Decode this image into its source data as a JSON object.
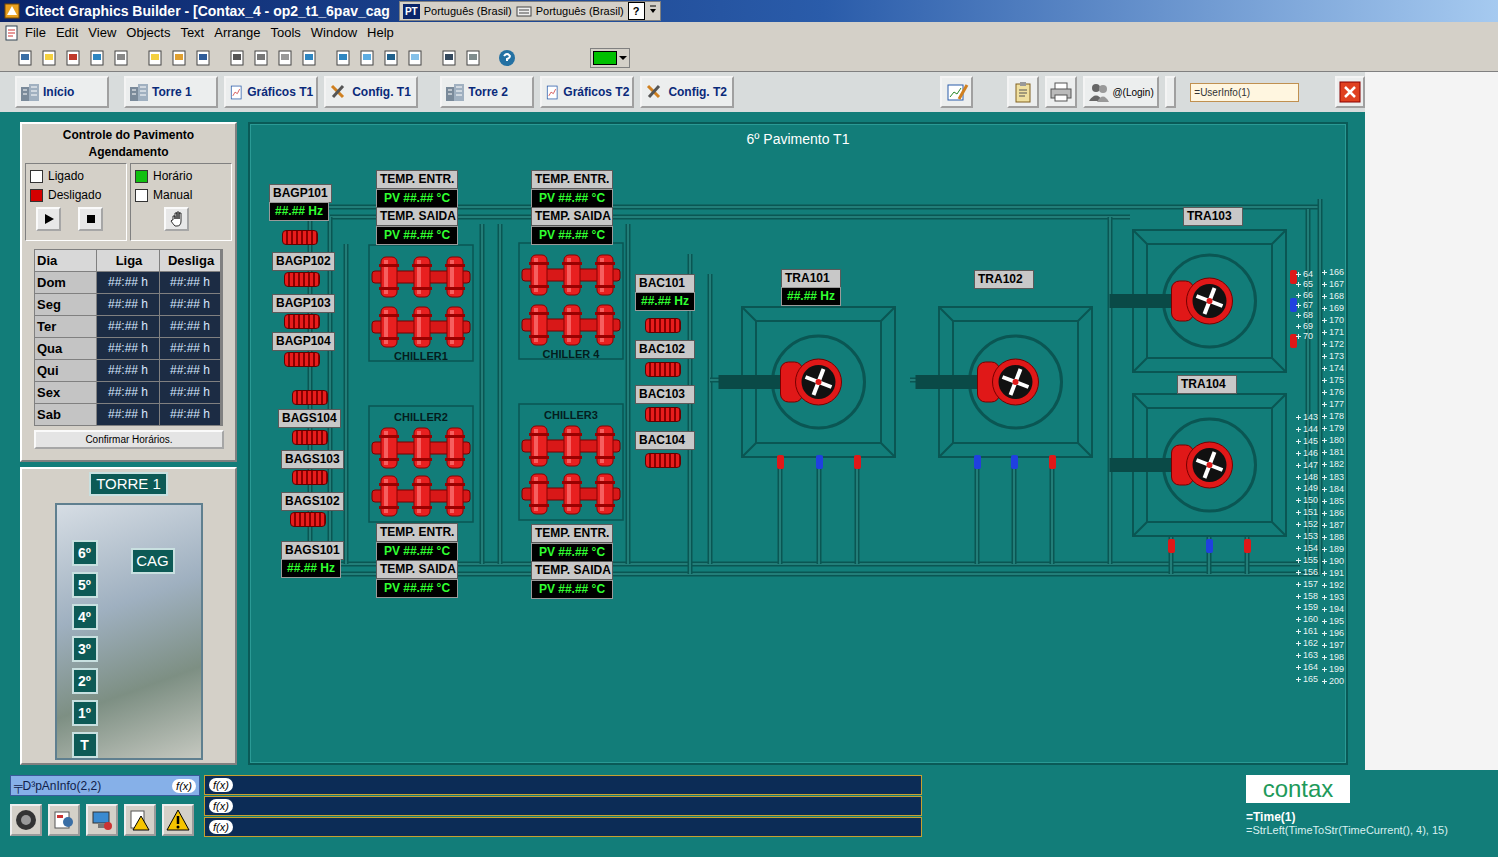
{
  "window": {
    "title": "Citect Graphics Builder - [Contax_4 - op2_t1_6pav_cag",
    "language_bar": [
      "PT",
      "Português (Brasil)",
      "Português (Brasil)",
      "?"
    ]
  },
  "menu": [
    "File",
    "Edit",
    "View",
    "Objects",
    "Text",
    "Arrange",
    "Tools",
    "Window",
    "Help"
  ],
  "toolbar": {
    "fill_color": "#00c000"
  },
  "nav": {
    "buttons": [
      "Início",
      "Torre 1",
      "Gráficos T1",
      "Config. T1",
      "Torre 2",
      "Gráficos T2",
      "Config. T2"
    ],
    "login": "@(Login)",
    "user_info": "=UserInfo(1)"
  },
  "schedule": {
    "title": "Controle do Pavimento",
    "subtitle": "Agendamento",
    "status": [
      {
        "label": "Ligado",
        "checked": false,
        "color": "#10c010"
      },
      {
        "label": "Desligado",
        "checked": true,
        "color": "#d40000"
      }
    ],
    "mode": [
      {
        "label": "Horário",
        "selected": true
      },
      {
        "label": "Manual",
        "selected": false
      }
    ],
    "columns": [
      "Dia",
      "Liga",
      "Desliga"
    ],
    "rows": [
      [
        "Dom",
        "##:## h",
        "##:## h"
      ],
      [
        "Seg",
        "##:## h",
        "##:## h"
      ],
      [
        "Ter",
        "##:## h",
        "##:## h"
      ],
      [
        "Qua",
        "##:## h",
        "##:## h"
      ],
      [
        "Qui",
        "##:## h",
        "##:## h"
      ],
      [
        "Sex",
        "##:## h",
        "##:## h"
      ],
      [
        "Sab",
        "##:## h",
        "##:## h"
      ]
    ],
    "confirm": "Confirmar Horários."
  },
  "tower": {
    "title": "TORRE 1",
    "floors": [
      "6º",
      "5º",
      "4º",
      "3º",
      "2º",
      "1º",
      "T"
    ],
    "cag": "CAG"
  },
  "diagram": {
    "title": "6º Pavimento T1",
    "pumps": [
      {
        "label": "BAGP101",
        "reading": "##.## Hz"
      },
      {
        "label": "BAGP102"
      },
      {
        "label": "BAGP103"
      },
      {
        "label": "BAGP104"
      },
      {
        "label": "BAGS104"
      },
      {
        "label": "BAGS103"
      },
      {
        "label": "BAGS102"
      },
      {
        "label": "BAGS101",
        "reading": "##.## Hz"
      }
    ],
    "condenser_pumps": [
      {
        "label": "BAC101",
        "reading": "##.## Hz"
      },
      {
        "label": "BAC102"
      },
      {
        "label": "BAC103"
      },
      {
        "label": "BAC104"
      }
    ],
    "temperatures": [
      {
        "label": "TEMP. ENTR.",
        "reading": "PV ##.## °C"
      },
      {
        "label": "TEMP. SAIDA",
        "reading": "PV ##.## °C"
      },
      {
        "label": "TEMP. ENTR.",
        "reading": "PV ##.## °C"
      },
      {
        "label": "TEMP. SAIDA",
        "reading": "PV ##.## °C"
      },
      {
        "label": "TEMP. ENTR.",
        "reading": "PV ##.## °C"
      },
      {
        "label": "TEMP. SAIDA",
        "reading": "PV ##.## °C"
      },
      {
        "label": "TEMP. ENTR.",
        "reading": "PV ##.## °C"
      },
      {
        "label": "TEMP. SAIDA",
        "reading": "PV ##.## °C"
      }
    ],
    "chillers": [
      "CHILLER1",
      "CHILLER 4",
      "CHILLER2",
      "CHILLER3"
    ],
    "towers": [
      {
        "label": "TRA101",
        "reading": "##.## Hz"
      },
      {
        "label": "TRA102"
      },
      {
        "label": "TRA103"
      },
      {
        "label": "TRA104"
      }
    ],
    "scale_left_top": [
      "64",
      "65",
      "66",
      "67",
      "68",
      "69",
      "70"
    ],
    "scale_left": [
      "143",
      "144",
      "145",
      "146",
      "147",
      "148",
      "149",
      "150",
      "151",
      "152",
      "153",
      "154",
      "155",
      "156",
      "157",
      "158",
      "159",
      "160",
      "161",
      "162",
      "163",
      "164",
      "165"
    ],
    "scale_right": [
      "166",
      "167",
      "168",
      "169",
      "170",
      "171",
      "172",
      "173",
      "174",
      "175",
      "176",
      "177",
      "178",
      "179",
      "180",
      "181",
      "182",
      "183",
      "184",
      "185",
      "186",
      "187",
      "188",
      "189",
      "190",
      "191",
      "192",
      "193",
      "194",
      "195",
      "196",
      "197",
      "198",
      "199",
      "200"
    ]
  },
  "bottom": {
    "alarm_field": "╤D³pAnInfo(2,2)",
    "fx": [
      "f(x)",
      "f(x)",
      "f(x)",
      "f(x)"
    ],
    "logo": "contax",
    "time": "=Time(1)",
    "date": "=StrLeft(TimeToStr(TimeCurrent(), 4), 15)"
  }
}
